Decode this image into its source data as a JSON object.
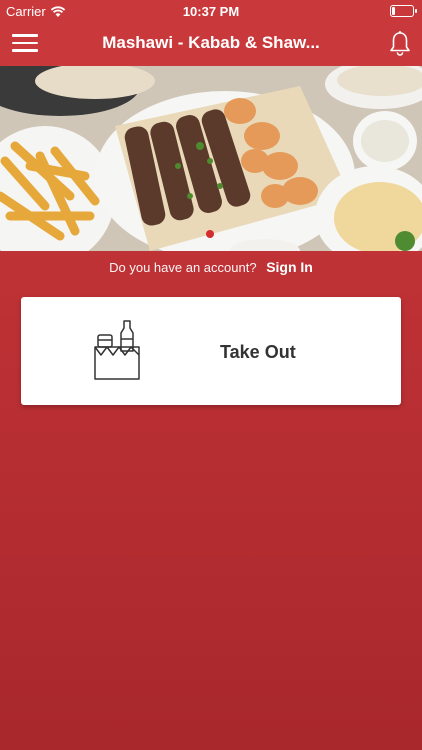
{
  "status_bar": {
    "carrier": "Carrier",
    "time": "10:37 PM"
  },
  "nav": {
    "title": "Mashawi - Kabab & Shaw...",
    "menu_icon": "hamburger-menu-icon",
    "bell_icon": "bell-icon"
  },
  "hero": {
    "image": "food-platter-photo"
  },
  "account": {
    "question": "Do you have an account?",
    "sign_in_label": "Sign In"
  },
  "options": [
    {
      "label": "Take Out",
      "icon": "takeout-bag-icon"
    }
  ],
  "colors": {
    "primary": "#c9393c",
    "card": "#ffffff",
    "card_text": "#333333"
  }
}
